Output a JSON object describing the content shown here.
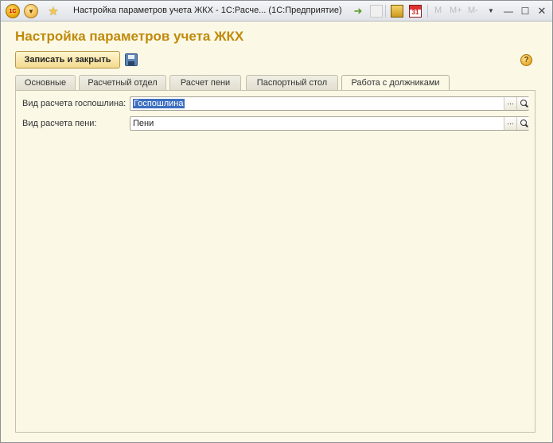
{
  "window": {
    "title": "Настройка параметров учета ЖКХ - 1С:Расче...  (1С:Предприятие)",
    "logo": "1С",
    "toolbar_right": [
      "M",
      "M+",
      "M-"
    ]
  },
  "form": {
    "title": "Настройка параметров учета ЖКХ",
    "save_close_label": "Записать и закрыть",
    "help_label": "?"
  },
  "tabs": [
    {
      "label": "Основные",
      "active": false
    },
    {
      "label": "Расчетный отдел",
      "active": false
    },
    {
      "label": "Расчет пени",
      "active": false
    },
    {
      "label": "Паспортный стол",
      "active": false
    },
    {
      "label": "Работа с должниками",
      "active": true
    }
  ],
  "fields": {
    "gosposhlina": {
      "label": "Вид расчета госпошлина:",
      "value": "Госпошлина"
    },
    "peni": {
      "label": "Вид расчета пени:",
      "value": "Пени"
    },
    "select_btn": "...",
    "calendar_day": "31"
  }
}
